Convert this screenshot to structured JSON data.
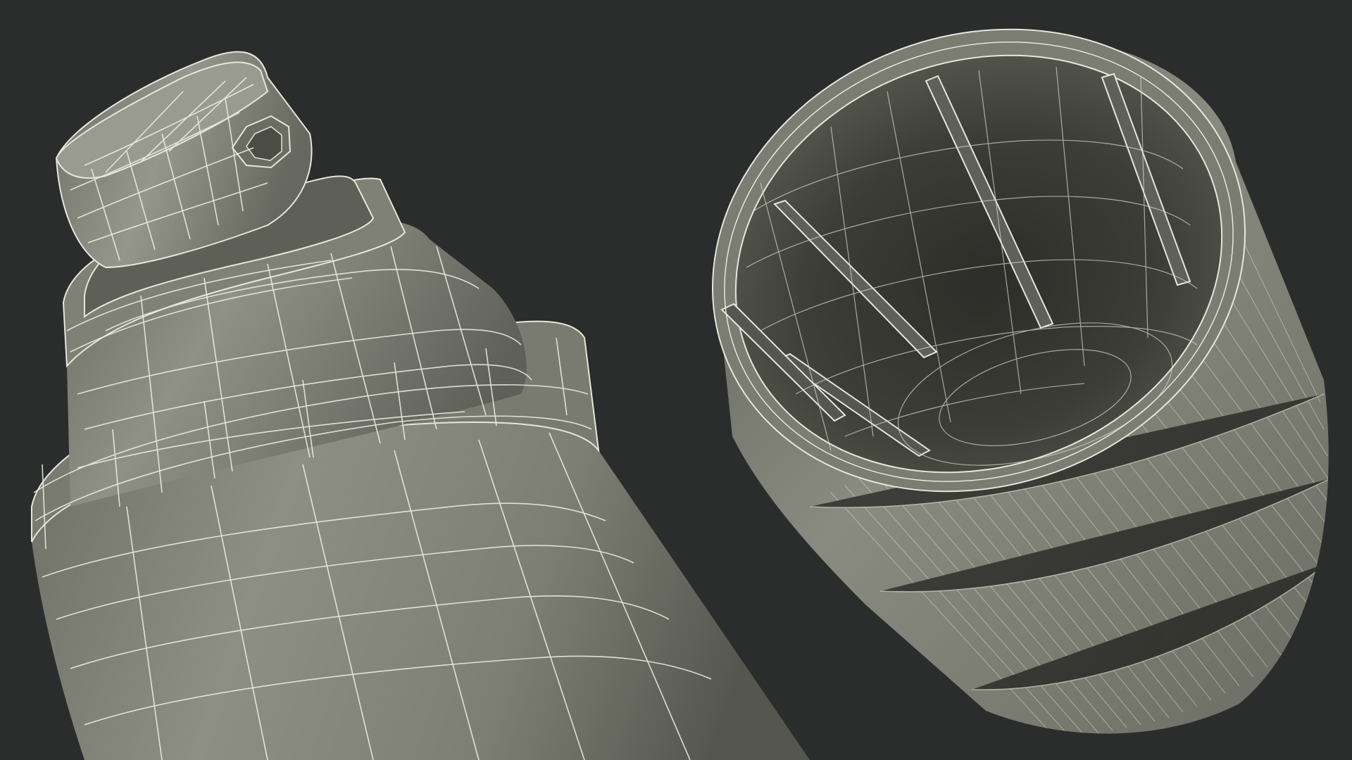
{
  "scene": {
    "subjects": [
      "spray-can-wireframe",
      "spray-cap-wireframe"
    ],
    "colors": {
      "background": "#2b2c2c",
      "surface_light": "#8c8c80",
      "surface_dark": "#4a4b44",
      "wire": "#e8e8dc",
      "interior": "#35362f"
    }
  }
}
